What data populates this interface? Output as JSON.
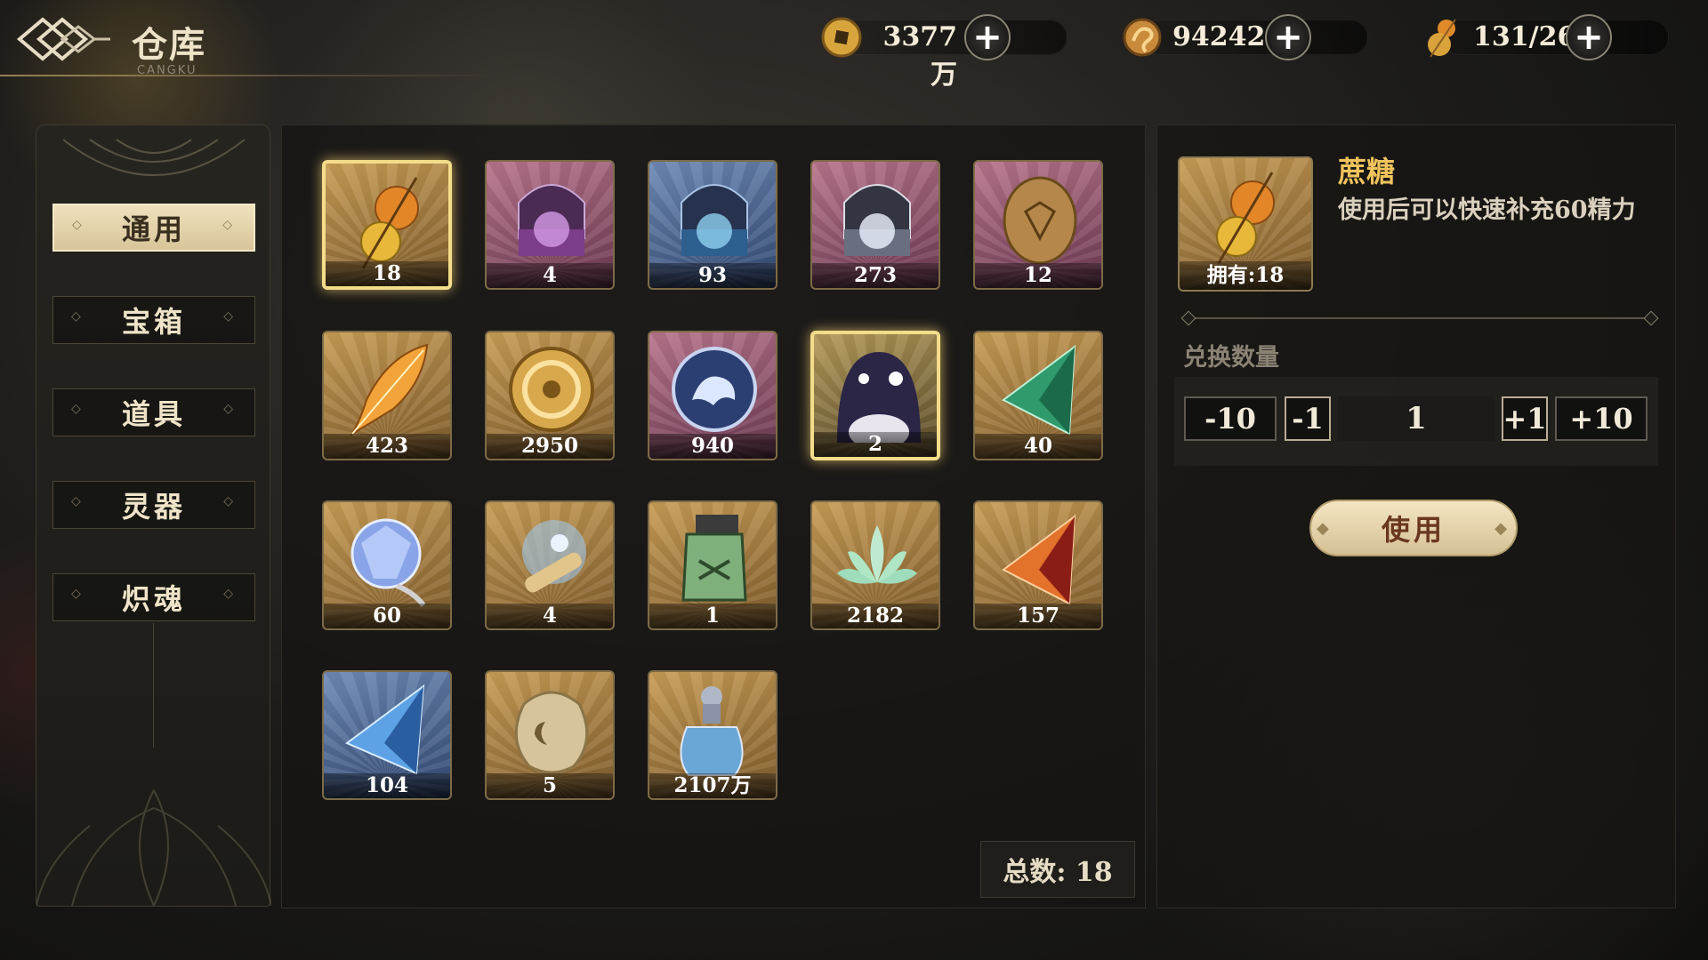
{
  "header": {
    "title": "仓库",
    "subtitle": "CANGKU"
  },
  "currencies": [
    {
      "icon": "copper-coin-icon",
      "value": "3377万"
    },
    {
      "icon": "jade-dragon-icon",
      "value": "94242"
    },
    {
      "icon": "gourd-energy-icon",
      "value": "131/266"
    }
  ],
  "sidebar": {
    "items": [
      {
        "label": "通用",
        "active": true
      },
      {
        "label": "宝箱",
        "active": false
      },
      {
        "label": "道具",
        "active": false
      },
      {
        "label": "灵器",
        "active": false
      },
      {
        "label": "炽魂",
        "active": false
      }
    ]
  },
  "grid": {
    "items": [
      {
        "icon": "candied-gourd-icon",
        "count": "18",
        "bg": "gold",
        "selected": true
      },
      {
        "icon": "purple-treasure-chest-icon",
        "count": "4",
        "bg": "purple"
      },
      {
        "icon": "blue-treasure-chest-icon",
        "count": "93",
        "bg": "blue"
      },
      {
        "icon": "silver-treasure-chest-icon",
        "count": "273",
        "bg": "purple"
      },
      {
        "icon": "bronze-token-icon",
        "count": "12",
        "bg": "purple"
      },
      {
        "icon": "golden-feather-icon",
        "count": "423",
        "bg": "gold"
      },
      {
        "icon": "golden-triskelion-icon",
        "count": "2950",
        "bg": "gold"
      },
      {
        "icon": "blue-beast-medallion-icon",
        "count": "940",
        "bg": "purple"
      },
      {
        "icon": "dark-spirit-creature-icon",
        "count": "2",
        "bg": "gold",
        "selected": true
      },
      {
        "icon": "green-crystal-icon",
        "count": "40",
        "bg": "gold"
      },
      {
        "icon": "blue-crystal-orb-icon",
        "count": "60",
        "bg": "gold"
      },
      {
        "icon": "spirit-scroll-icon",
        "count": "4",
        "bg": "gold"
      },
      {
        "icon": "jade-talisman-icon",
        "count": "1",
        "bg": "gold"
      },
      {
        "icon": "jade-lotus-icon",
        "count": "2182",
        "bg": "gold"
      },
      {
        "icon": "fire-crystal-icon",
        "count": "157",
        "bg": "gold"
      },
      {
        "icon": "blue-pyramid-crystal-icon",
        "count": "104",
        "bg": "blue"
      },
      {
        "icon": "moon-amber-stone-icon",
        "count": "5",
        "bg": "gold"
      },
      {
        "icon": "potion-bottle-icon",
        "count": "2107万",
        "bg": "gold"
      }
    ],
    "total_label": "总数: 18"
  },
  "detail": {
    "name": "蔗糖",
    "description": "使用后可以快速补充60精力",
    "owned_label": "拥有:18",
    "quantity_label": "兑换数量",
    "buttons": {
      "minus10": "-10",
      "minus1": "-1",
      "plus1": "+1",
      "plus10": "+10"
    },
    "quantity_value": "1",
    "use_label": "使用"
  },
  "colors": {
    "accent_gold": "#f0c35c",
    "selected_border": "#f3dc8a",
    "use_button": "#e8d6ad"
  }
}
